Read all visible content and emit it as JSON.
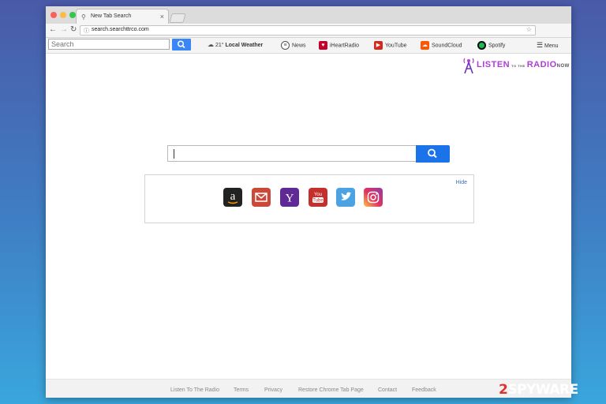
{
  "browser": {
    "tab_title": "New Tab Search",
    "url": "search.searchttrco.com"
  },
  "toolbar": {
    "search_placeholder": "Search",
    "weather_temp": "21°",
    "weather_label": "Local Weather",
    "items": [
      "News",
      "iHeartRadio",
      "YouTube",
      "SoundCloud",
      "Spotify"
    ],
    "menu_label": "Menu"
  },
  "logo": {
    "text": "LISTEN",
    "small_text": "TO THE",
    "text2": "RADIO",
    "now": "NOW"
  },
  "shortcuts": {
    "hide_label": "Hide",
    "icons": [
      "amazon-icon",
      "mail-icon",
      "yahoo-icon",
      "youtube-icon",
      "twitter-icon",
      "instagram-icon"
    ],
    "amazon_letter": "a",
    "yahoo_letter": "Y",
    "youtube_text": "You\nTube"
  },
  "footer": {
    "links": [
      "Listen To The Radio",
      "Terms",
      "Privacy",
      "Restore Chrome Tab Page",
      "Contact",
      "Feedback"
    ]
  },
  "watermark": {
    "num": "2",
    "text": "SPYWARE"
  },
  "colors": {
    "search_blue": "#1a73e8",
    "toolbar_blue": "#3b86f7",
    "logo_purple": "#b03cd8"
  }
}
